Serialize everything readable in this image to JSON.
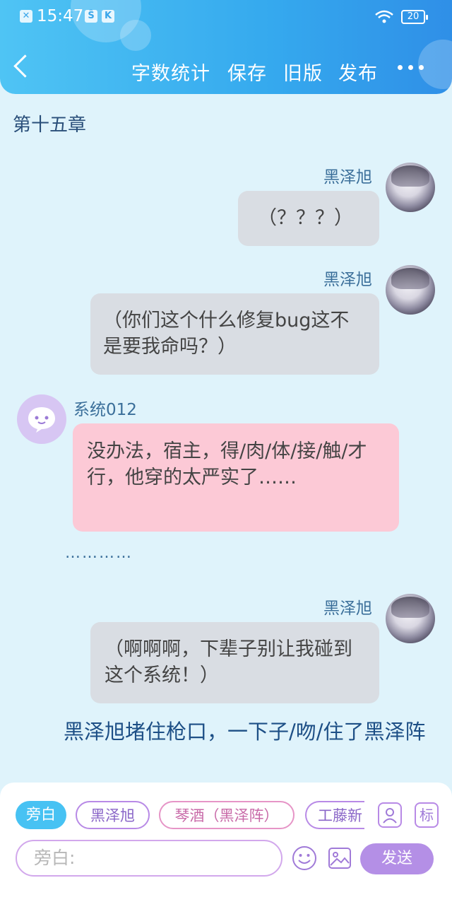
{
  "status_bar": {
    "time": "15:47",
    "battery": "20"
  },
  "header": {
    "word_count": "字数统计",
    "save": "保存",
    "old_version": "旧版",
    "publish": "发布"
  },
  "chapter_title": "第十五章",
  "messages": [
    {
      "speaker": "黑泽旭",
      "text": "（？？？）"
    },
    {
      "speaker": "黑泽旭",
      "text": "（你们这个什么修复bug这不是要我命吗？）"
    },
    {
      "speaker": "系统012",
      "text": "没办法，宿主，得/肉/体/接/触/才行，他穿的太严实了……"
    },
    {
      "speaker": "黑泽旭",
      "text": "（啊啊啊，下辈子别让我碰到这个系统！）"
    }
  ],
  "separator_dots": "…………",
  "narration": "黑泽旭堵住枪口，一下子/吻/住了黑泽阵",
  "role_chips": [
    "旁白",
    "黑泽旭",
    "琴酒（黑泽阵）",
    "工藤新"
  ],
  "icon_buttons": {
    "role_icon": "person-icon",
    "mark_label": "标"
  },
  "input": {
    "placeholder": "旁白:"
  },
  "send_label": "发送",
  "colors": {
    "accent": "#47c2f3",
    "purple": "#b48fe6",
    "pink_bubble": "#fcc9d6",
    "gray_bubble": "#d9dde3"
  }
}
